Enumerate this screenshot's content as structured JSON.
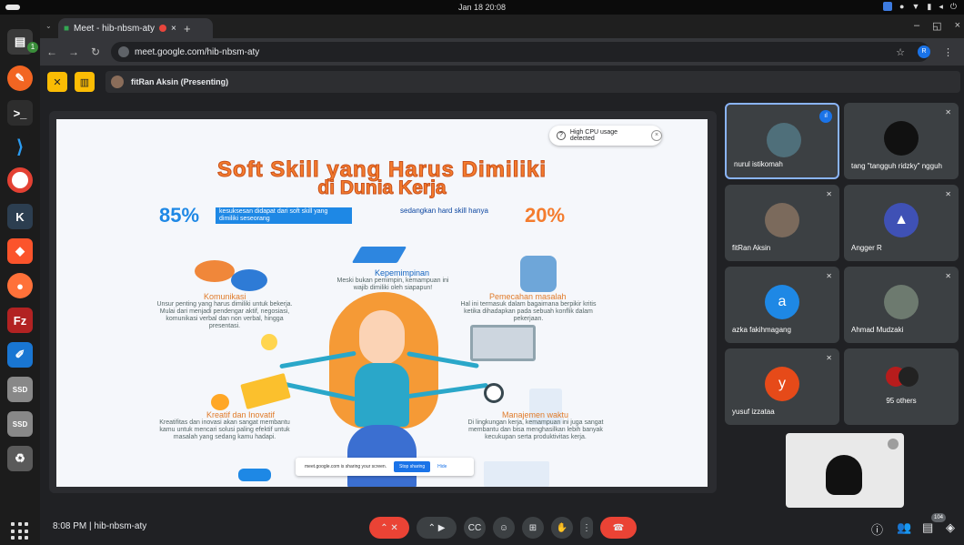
{
  "system": {
    "clock": "Jan 18  20:08"
  },
  "dock": {
    "badge_count": "1"
  },
  "browser": {
    "tab_title": "Meet - hib-nbsm-aty",
    "url": "meet.google.com/hib-nbsm-aty",
    "profile_initial": "R"
  },
  "presenter": {
    "label": "fitRan Aksin (Presenting)"
  },
  "slide": {
    "title_line1": "Soft Skill yang Harus Dimiliki",
    "title_line2": "di Dunia Kerja",
    "stat_left_value": "85%",
    "stat_left_text": "kesuksesan didapat dari soft skill yang dimiliki seseorang",
    "stat_right_text": "sedangkan hard skill hanya",
    "stat_right_value": "20%",
    "kepemimpinan": "Kepemimpinan",
    "kepemimpinan_desc": "Meski bukan pemimpin, kemampuan ini wajib dimiliki oleh siapapun!",
    "komunikasi": "Komunikasi",
    "komunikasi_desc": "Unsur penting yang harus dimiliki untuk bekerja. Mulai dari menjadi pendengar aktif, negosiasi, komunikasi verbal dan non verbal, hingga presentasi.",
    "pemecahan": "Pemecahan masalah",
    "pemecahan_desc": "Hal ini termasuk dalam bagaimana berpikir kritis ketika dihadapkan pada sebuah konflik dalam pekerjaan.",
    "kreatif": "Kreatif dan Inovatif",
    "kreatif_desc": "Kreatifitas dan inovasi akan sangat membantu kamu untuk mencari solusi paling efektif untuk masalah yang sedang kamu hadapi.",
    "manajemen": "Manajemen waktu",
    "manajemen_desc": "Di lingkungan kerja, kemampuan ini juga sangat membantu dan bisa menghasilkan lebih banyak kecukupan serta produktivitas kerja."
  },
  "cpu_notice": "High CPU usage detected",
  "share_bar": {
    "text": "meet.google.com is sharing your screen.",
    "stop": "Stop sharing",
    "hide": "Hide"
  },
  "participants": [
    {
      "name": "nurul istikomah",
      "avatar_color": "#4f6f7a",
      "initial": ""
    },
    {
      "name": "tang \"tangguh ridzky\" ngguh",
      "avatar_color": "#111111",
      "initial": ""
    },
    {
      "name": "fitRan Aksin",
      "avatar_color": "#7b6a5c",
      "initial": ""
    },
    {
      "name": "Angger R",
      "avatar_color": "#3f51b5",
      "initial": ""
    },
    {
      "name": "azka fakihmagang",
      "avatar_color": "#1e88e5",
      "initial": "a"
    },
    {
      "name": "Ahmad Mudzaki",
      "avatar_color": "#6d7a6f",
      "initial": ""
    },
    {
      "name": "yusuf izzataa",
      "avatar_color": "#e64a19",
      "initial": "y"
    },
    {
      "name": "95 others",
      "avatar_color": "#b71c1c",
      "initial": ""
    }
  ],
  "toolbar": {
    "time": "8:08 PM",
    "separator": "|",
    "meeting_code": "hib-nbsm-aty",
    "participant_count": "104"
  }
}
